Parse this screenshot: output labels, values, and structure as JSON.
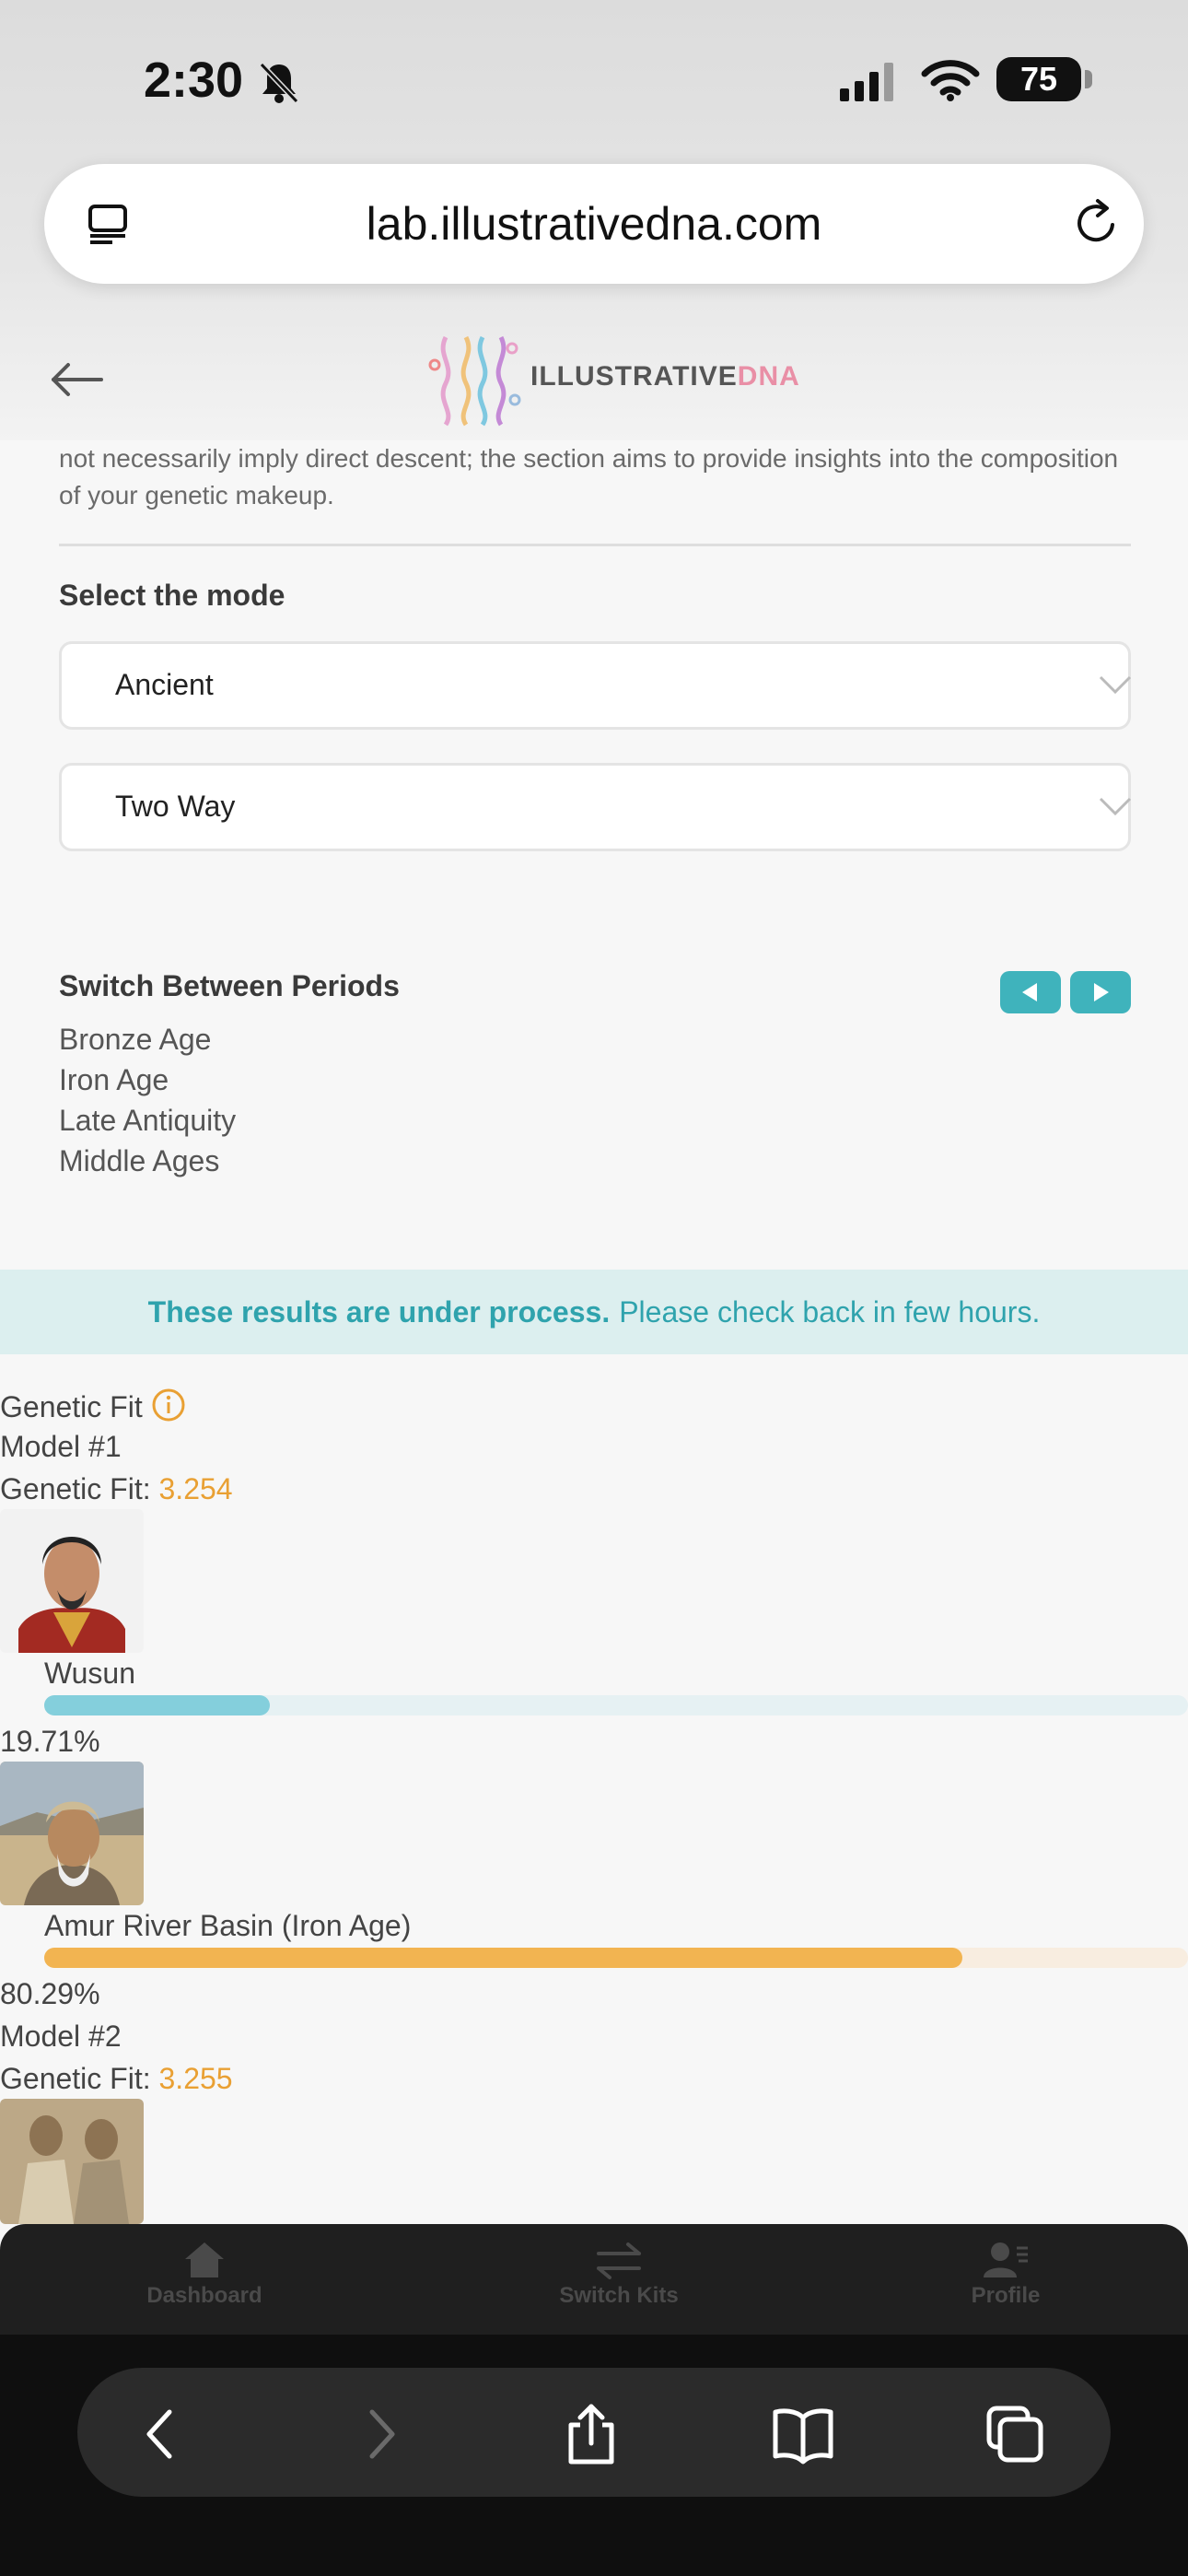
{
  "status": {
    "time": "2:30",
    "battery": "75"
  },
  "browser": {
    "url": "lab.illustrativedna.com"
  },
  "site": {
    "logo_text_main": "ILLUSTRATIVE",
    "logo_text_accent": "DNA"
  },
  "intro": {
    "text": "not necessarily imply direct descent; the section aims to provide insights into the composition of your genetic makeup."
  },
  "mode": {
    "title": "Select the mode",
    "select1": "Ancient",
    "select2": "Two Way"
  },
  "periods": {
    "title": "Switch Between Periods",
    "items": [
      "Bronze Age",
      "Iron Age",
      "Late Antiquity",
      "Middle Ages"
    ]
  },
  "banner": {
    "bold": "These results are under process.",
    "rest": "Please check back in few hours."
  },
  "results": {
    "heading": "Genetic Fit",
    "fit_label": "Genetic Fit:",
    "models": [
      {
        "label": "Model #1",
        "fit": "3.254",
        "populations": [
          {
            "name": "Wusun",
            "percent": "19.71%",
            "value": 19.71,
            "color": "#84cfdc",
            "track": "#e6f1f3"
          },
          {
            "name": "Amur River Basin (Iron Age)",
            "percent": "80.29%",
            "value": 80.29,
            "color": "#f2b451",
            "track": "#f8ede0"
          }
        ]
      },
      {
        "label": "Model #2",
        "fit": "3.255"
      }
    ]
  },
  "appnav": {
    "items": [
      "Dashboard",
      "Switch Kits",
      "Profile"
    ]
  }
}
